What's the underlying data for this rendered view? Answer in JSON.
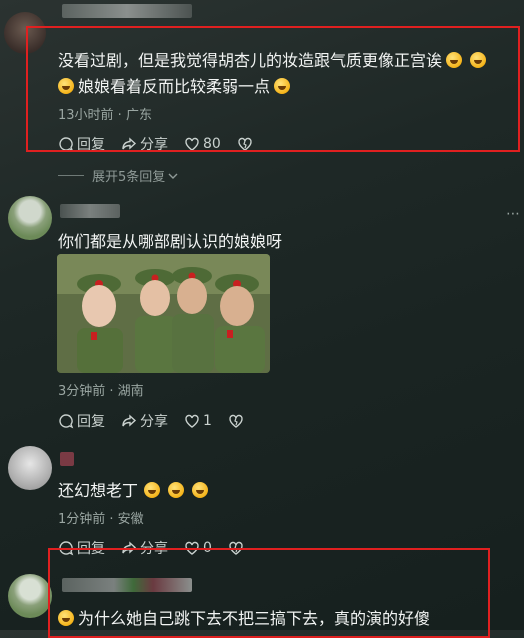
{
  "comments": [
    {
      "text_line1": "没看过剧，但是我觉得胡杏儿的妆造跟气质更像正宫诶",
      "text_line2": "娘娘看着反而比较柔弱一点",
      "meta": "13小时前 · 广东",
      "reply_label": "回复",
      "share_label": "分享",
      "like_count": "80"
    },
    {
      "expand_label": "展开5条回复"
    },
    {
      "text": "你们都是从哪部剧认识的娘娘呀",
      "meta": "3分钟前 · 湖南",
      "reply_label": "回复",
      "share_label": "分享",
      "like_count": "1"
    },
    {
      "text": "还幻想老丁",
      "meta": "1分钟前 · 安徽",
      "reply_label": "回复",
      "share_label": "分享",
      "like_count": "0"
    },
    {
      "text": "为什么她自己跳下去不把三搞下去，真的演的好傻"
    }
  ],
  "colors": {
    "highlight_box": "#e02020",
    "background": "#1e2826"
  }
}
